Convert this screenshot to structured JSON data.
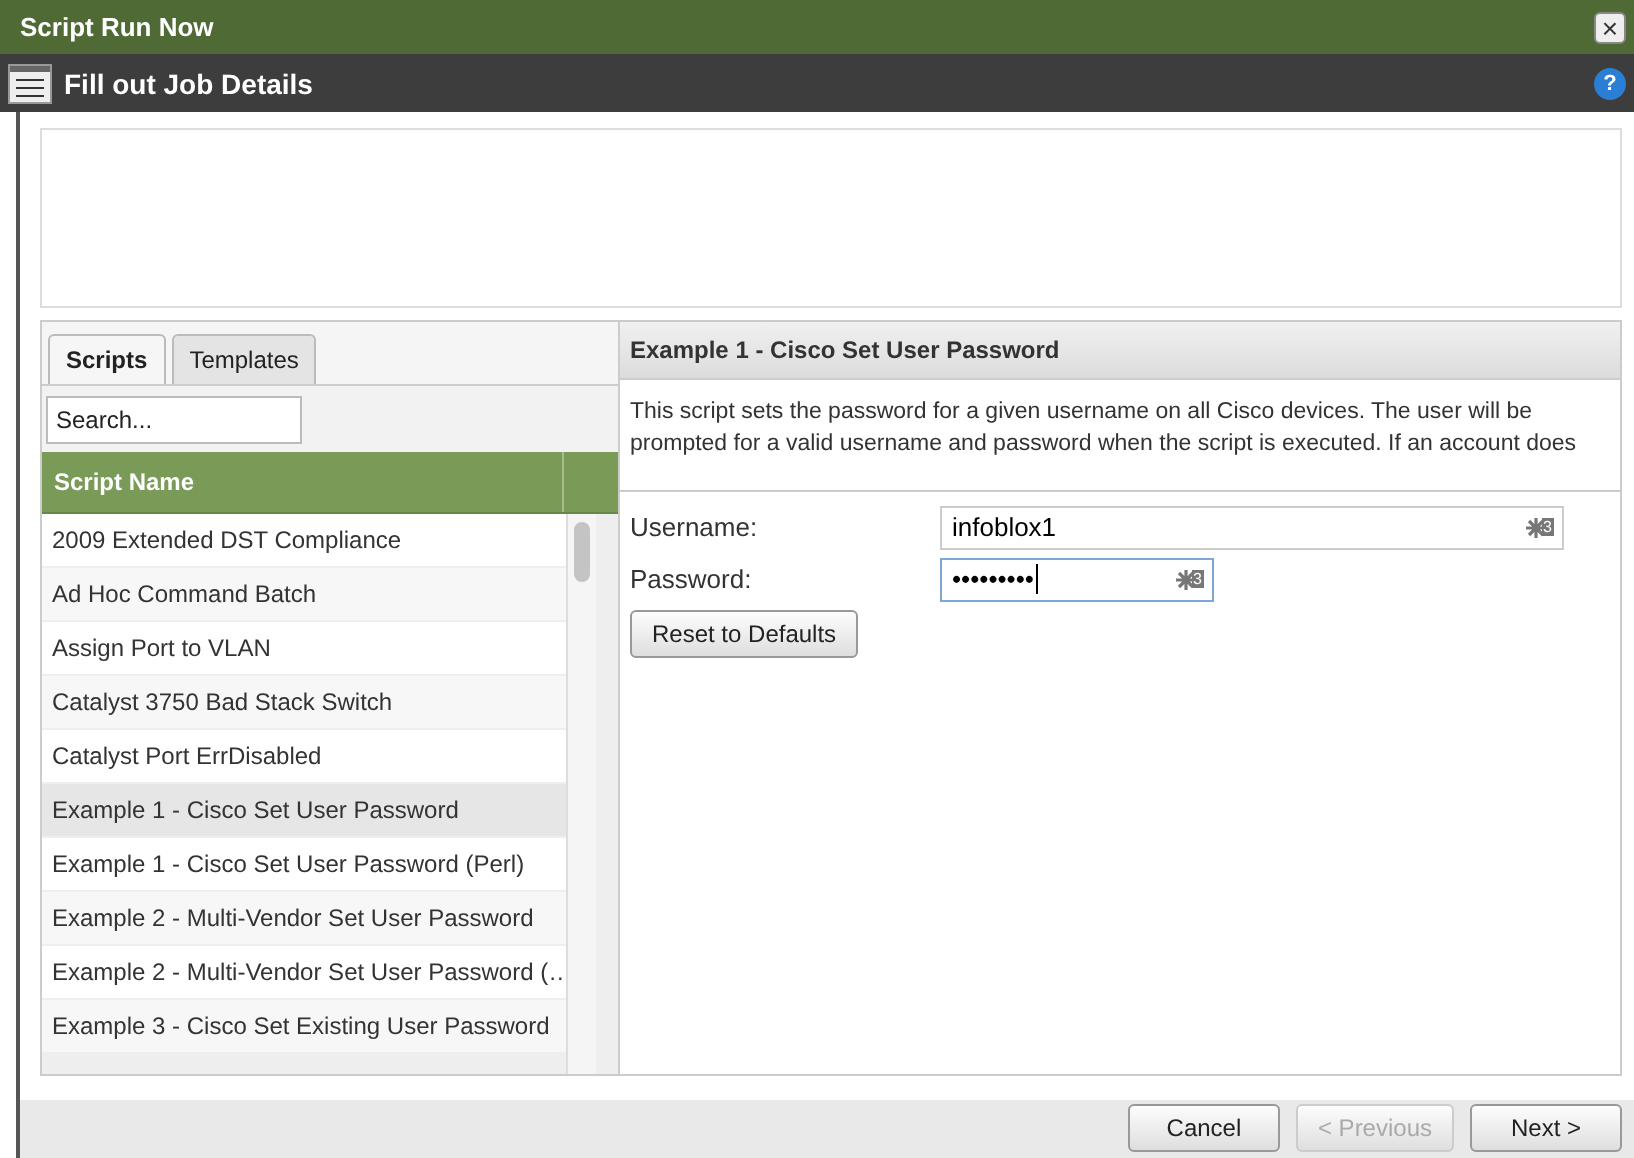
{
  "window": {
    "title": "Script Run Now",
    "close": "×"
  },
  "header": {
    "title": "Fill out Job Details",
    "help": "?"
  },
  "tabs": [
    {
      "label": "Scripts",
      "selected": true
    },
    {
      "label": "Templates",
      "selected": false
    }
  ],
  "search": {
    "placeholder": "Search..."
  },
  "table": {
    "columns": [
      "Script Name"
    ],
    "rows": [
      {
        "name": "2009 Extended DST Compliance",
        "selected": false
      },
      {
        "name": "Ad Hoc Command Batch",
        "selected": false
      },
      {
        "name": "Assign Port to VLAN",
        "selected": false
      },
      {
        "name": "Catalyst 3750 Bad Stack Switch",
        "selected": false
      },
      {
        "name": "Catalyst Port ErrDisabled",
        "selected": false
      },
      {
        "name": "Example 1 - Cisco Set User Password",
        "selected": true
      },
      {
        "name": "Example 1 - Cisco Set User Password (Perl)",
        "selected": false
      },
      {
        "name": "Example 2 - Multi-Vendor Set User Password",
        "selected": false
      },
      {
        "name": "Example 2 - Multi-Vendor Set User Password (…",
        "selected": false
      },
      {
        "name": "Example 3 - Cisco Set Existing User Password",
        "selected": false
      }
    ]
  },
  "detail": {
    "title": "Example 1 - Cisco Set User Password",
    "description": "This script sets the password for a given username on all Cisco devices. The user will be prompted for a valid username and password when the script is executed. If an account does",
    "fields": [
      {
        "label": "Username:",
        "value": "infoblox1",
        "kind": "text",
        "badge": "3"
      },
      {
        "label": "Password:",
        "value": "•••••••••",
        "kind": "password",
        "badge": "3"
      }
    ],
    "reset": "Reset to Defaults"
  },
  "buttons": [
    {
      "label": "Cancel",
      "disabled": false
    },
    {
      "label": "< Previous",
      "disabled": true
    },
    {
      "label": "Next >",
      "disabled": false
    }
  ]
}
